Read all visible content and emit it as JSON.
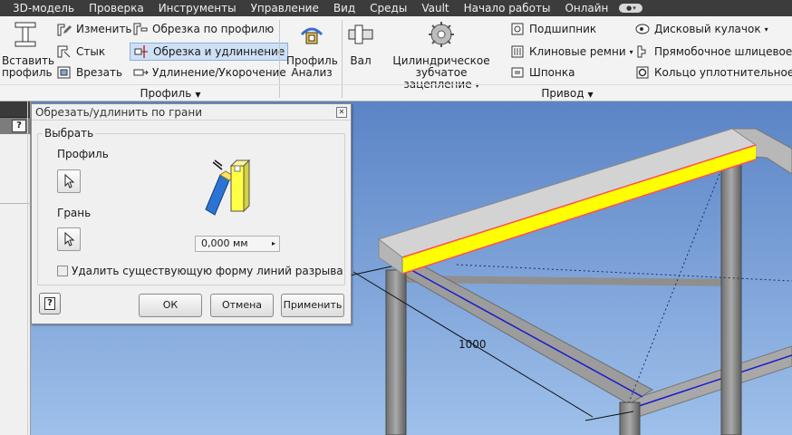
{
  "menu": [
    "3D-модель",
    "Проверка",
    "Инструменты",
    "Управление",
    "Вид",
    "Среды",
    "Vault",
    "Начало работы",
    "Онлайн"
  ],
  "ribbon": {
    "insert_profile": {
      "line1": "Вставить",
      "line2": "профиль"
    },
    "edit": "Изменить",
    "joint": "Стык",
    "notch": "Врезать",
    "trim_to_profile": "Обрезка по профилю",
    "trim_extend": "Обрезка и удлиннение",
    "lengthen_shorten": "Удлинение/Укорочение",
    "profile_analysis": {
      "line1": "Профиль",
      "line2": "Анализ"
    },
    "shaft": "Вал",
    "spur_gear": {
      "line1": "Цилиндрическое",
      "line2": "зубчатое зацепление"
    },
    "bearing": "Подшипник",
    "vbelts": "Клиновые ремни",
    "key": "Шпонка",
    "disc_cam": "Дисковый кулачок",
    "spline": "Прямобочное шлицевое со",
    "oring": "Кольцо уплотнительное",
    "panel_profile": "Профиль",
    "panel_drive": "Привод"
  },
  "dialog": {
    "title": "Обрезать/удлинить по грани",
    "group_label": "Выбрать",
    "profile_label": "Профиль",
    "face_label": "Грань",
    "offset_value": "0,000 мм",
    "delete_checkbox_label": "Удалить существующую форму линий разрыва",
    "delete_checked": false,
    "ok": "ОК",
    "cancel": "Отмена",
    "apply": "Применить",
    "help": "?"
  },
  "viewport": {
    "dimension_value": "1000",
    "colors": {
      "background": "#6b90c8",
      "beam": "#cfcfcf",
      "highlight": "#ffff00",
      "selection_edge": "#ff5050",
      "edge": "#1a1acc"
    }
  },
  "left_panel": {
    "help": "?"
  }
}
